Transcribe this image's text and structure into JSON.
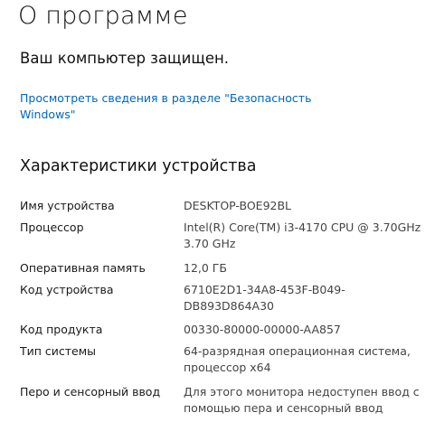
{
  "page": {
    "title": "О программе",
    "protection_status": "Ваш компьютер защищен.",
    "security_link": "Просмотреть сведения в разделе \"Безопасность Windows\""
  },
  "device_specs": {
    "title": "Характеристики устройства",
    "rows": [
      {
        "label": "Имя устройства",
        "value": "DESKTOP-BOE92BL"
      },
      {
        "label": "Процессор",
        "value": "Intel(R) Core(TM) i3-4170 CPU @ 3.70GHz 3.70 GHz"
      },
      {
        "label": "Оперативная память",
        "value": "12,0 ГБ"
      },
      {
        "label": "Код устройства",
        "value": "6710E2D1-34A8-453F-B049-DB893D864A30"
      },
      {
        "label": "Код продукта",
        "value": "00330-80000-00000-AA857"
      },
      {
        "label": "Тип системы",
        "value": "64-разрядная операционная система, процессор x64"
      },
      {
        "label": "Перо и сенсорный ввод",
        "value": "Для этого монитора недоступен ввод с помощью пера и сенсорный ввод"
      }
    ]
  },
  "colors": {
    "link": "#0067b8",
    "text": "#1a1a1a",
    "value_text": "#444444",
    "background": "#ffffff"
  }
}
